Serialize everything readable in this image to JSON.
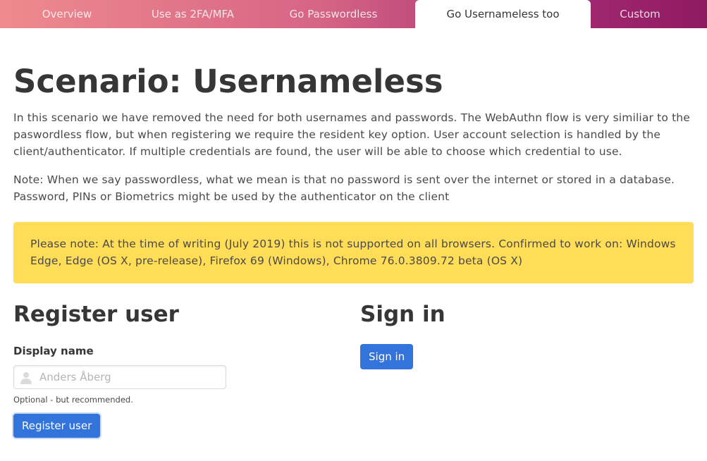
{
  "nav": {
    "tabs": [
      {
        "label": "Overview"
      },
      {
        "label": "Use as 2FA/MFA"
      },
      {
        "label": "Go Passwordless"
      },
      {
        "label": "Go Usernameless too"
      },
      {
        "label": "Custom"
      }
    ],
    "active_tab": "Go Usernameless too",
    "gradient_colors": [
      "#ef8a8e",
      "#8e1a63"
    ]
  },
  "page": {
    "title": "Scenario: Usernameless",
    "intro": "In this scenario we have removed the need for both usernames and passwords. The WebAuthn flow is very similiar to the paswordless flow, but when registering we require the resident key option. User account selection is handled by the client/authenticator. If multiple credentials are found, the user will be able to choose which credential to use.",
    "note": "Note: When we say passwordless, what we mean is that no password is sent over the internet or stored in a database. Password, PINs or Biometrics might be used by the authenticator on the client"
  },
  "notice": {
    "text": "Please note: At the time of writing (July 2019) this is not supported on all browsers. Confirmed to work on: Windows Edge, Edge (OS X, pre-release), Firefox 69 (Windows), Chrome 76.0.3809.72 beta (OS X)",
    "color": "#ffdd57"
  },
  "register": {
    "heading": "Register user",
    "display_name_label": "Display name",
    "display_name_placeholder": "Anders Åberg",
    "display_name_value": "",
    "help": "Optional - but recommended.",
    "button_label": "Register user",
    "field_icon": "user-icon"
  },
  "signin": {
    "heading": "Sign in",
    "button_label": "Sign in"
  },
  "colors": {
    "primary": "#3273dc",
    "heading": "#363636",
    "text": "#4a4a4a"
  }
}
